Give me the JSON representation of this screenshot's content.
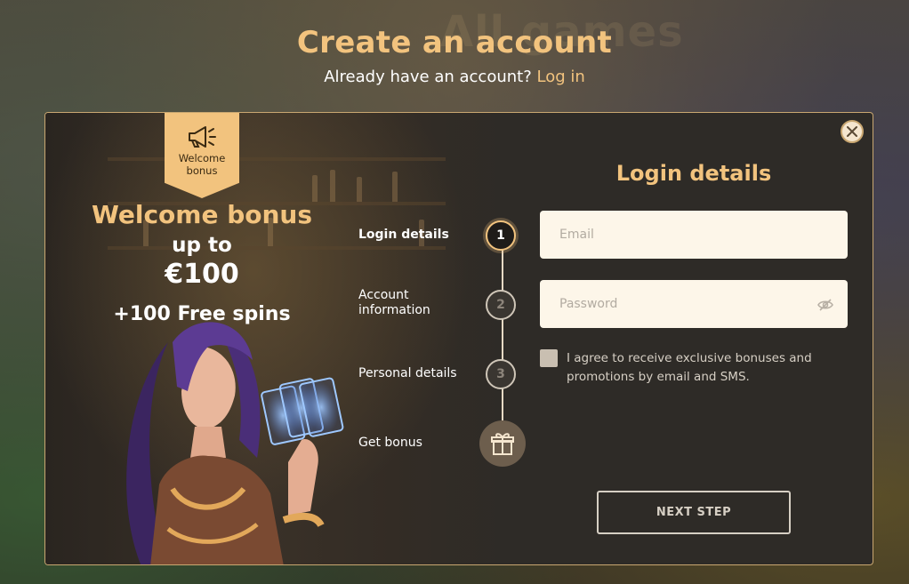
{
  "background": {
    "ghost_text": "All games"
  },
  "header": {
    "title": "Create an account",
    "subtitle_prefix": "Already have an account?",
    "login_link": "Log in"
  },
  "promo": {
    "ribbon_icon": "megaphone-icon",
    "ribbon_label": "Welcome bonus",
    "title": "Welcome bonus",
    "up_to": "up to",
    "amount": "€100",
    "spins": "+100 Free spins"
  },
  "steps": [
    {
      "number": "1",
      "label": "Login details",
      "active": true
    },
    {
      "number": "2",
      "label": "Account information",
      "active": false
    },
    {
      "number": "3",
      "label": "Personal details",
      "active": false
    },
    {
      "label": "Get bonus",
      "icon": "gift-icon"
    }
  ],
  "form": {
    "title": "Login details",
    "email_placeholder": "Email",
    "password_placeholder": "Password",
    "password_toggle_icon": "eye-slash-icon",
    "consent_text": "I agree to receive exclusive bonuses and promotions by email and SMS.",
    "next_button": "NEXT STEP"
  },
  "close_icon": "close-icon",
  "colors": {
    "accent": "#f2c37e",
    "modal_bg": "#2e2b27",
    "input_bg": "#fdf6e9"
  }
}
